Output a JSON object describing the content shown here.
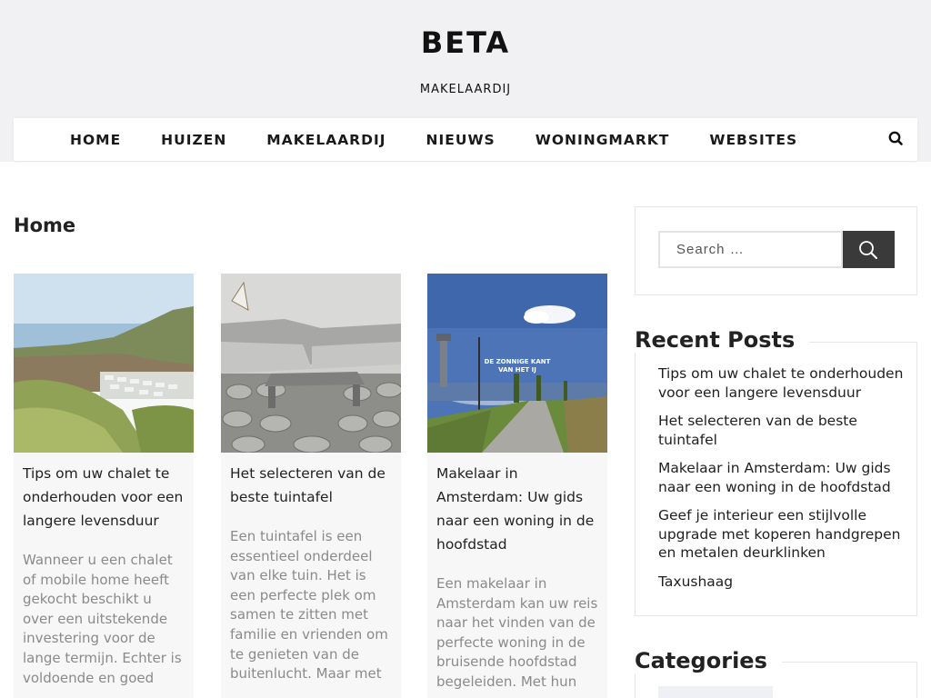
{
  "site": {
    "title": "BETA",
    "tagline": "MAKELAARDIJ"
  },
  "nav": {
    "items": [
      "HOME",
      "HUIZEN",
      "MAKELAARDIJ",
      "NIEUWS",
      "WONINGMARKT",
      "WEBSITES"
    ],
    "search_icon": "search-icon"
  },
  "main": {
    "heading": "Home",
    "posts": [
      {
        "title": "Tips om uw chalet te onderhouden voor een langere levensduur",
        "excerpt": "Wanneer u een chalet of mobile home heeft gekocht beschikt u over een uitstekende investering voor de lange termijn. Echter is voldoende en goed",
        "image": "coastal-chalet-park-photo"
      },
      {
        "title": "Het selecteren van de beste tuintafel",
        "excerpt": "Een tuintafel is een essentieel onderdeel van elke tuin. Het is een perfecte plek om samen te zitten met familie en vrienden om te genieten van de buitenlucht. Maar met",
        "image": "garden-lounge-set-photo"
      },
      {
        "title": "Makelaar in Amsterdam: Uw gids naar een woning in de hoofdstad",
        "excerpt": "Een makelaar in Amsterdam kan uw reis naar het vinden van de perfecte woning in de bruisende hoofdstad begeleiden. Met hun",
        "image": "amsterdam-street-photo",
        "image_caption_line1": "DE ZONNIGE KANT",
        "image_caption_line2": "VAN HET IJ"
      }
    ]
  },
  "sidebar": {
    "search": {
      "placeholder": "Search …",
      "button_icon": "search-icon"
    },
    "recent_posts": {
      "heading": "Recent Posts",
      "items": [
        "Tips om uw chalet te onderhouden voor een langere levensduur",
        "Het selecteren van de beste tuintafel",
        "Makelaar in Amsterdam: Uw gids naar een woning in de hoofdstad",
        "Geef je interieur een stijlvolle upgrade met koperen handgrepen en metalen deurklinken",
        "Taxushaag"
      ]
    },
    "categories": {
      "heading": "Categories"
    }
  },
  "colors": {
    "header_bg": "#f1f1f3",
    "card_bg": "#f7f7f8",
    "excerpt_text": "#8a8a8a",
    "search_button": "#3a3a3a"
  }
}
